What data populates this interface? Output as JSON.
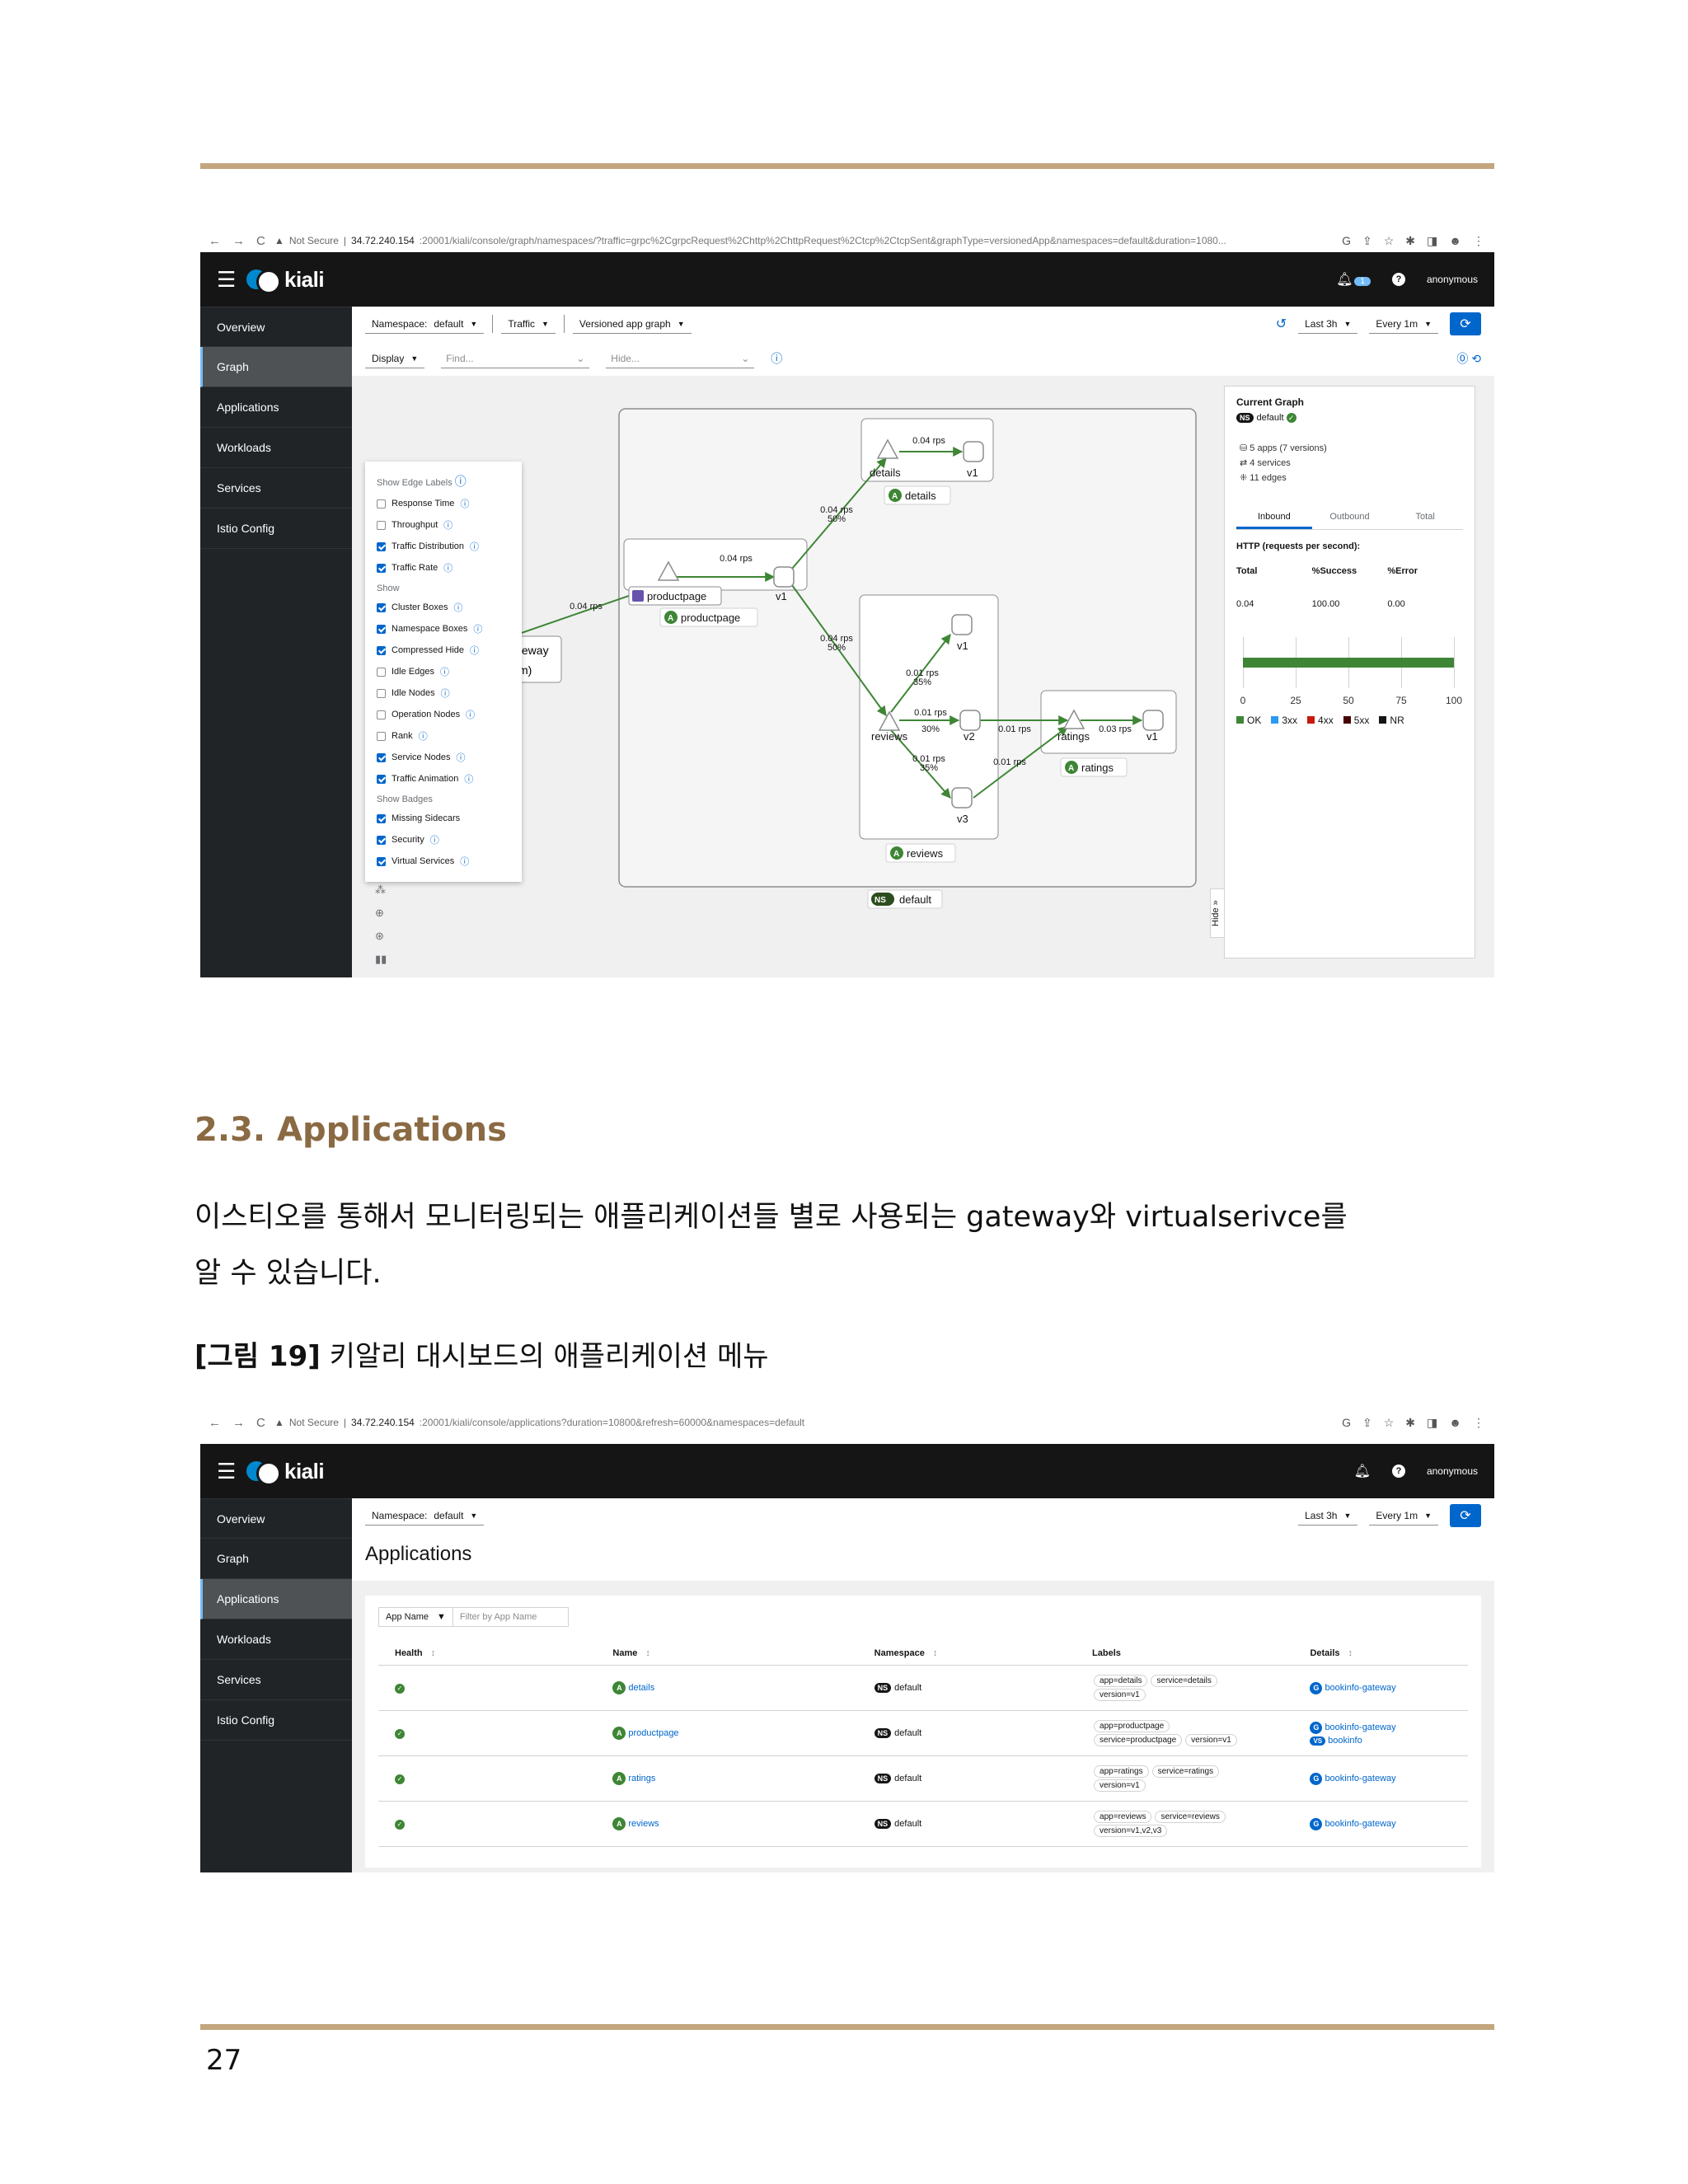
{
  "screenshot1": {
    "nav_back": "←",
    "nav_forward": "→",
    "nav_reload": "C",
    "security": "Not Secure",
    "host": "34.72.240.154",
    "path": ":20001/kiali/console/graph/namespaces/?traffic=grpc%2CgrpcRequest%2Chttp%2ChttpRequest%2Ctcp%2CtcpSent&graphType=versionedApp&namespaces=default&duration=1080...",
    "app_name": "kiali",
    "user": "anonymous",
    "notif_count": "1",
    "sidebar": [
      "Overview",
      "Graph",
      "Applications",
      "Workloads",
      "Services",
      "Istio Config"
    ],
    "active_item": "Graph",
    "toolbar": {
      "namespace_label": "Namespace:",
      "namespace_value": "default",
      "traffic": "Traffic",
      "graph_type": "Versioned app graph",
      "range": "Last 3h",
      "refresh": "Every 1m"
    },
    "subbar": {
      "display": "Display",
      "find_placeholder": "Find...",
      "hide_placeholder": "Hide..."
    },
    "display_menu": {
      "edge_labels_header": "Show Edge Labels",
      "edge_labels": [
        {
          "label": "Response Time",
          "checked": false
        },
        {
          "label": "Throughput",
          "checked": false
        },
        {
          "label": "Traffic Distribution",
          "checked": true
        },
        {
          "label": "Traffic Rate",
          "checked": true
        }
      ],
      "show_header": "Show",
      "show": [
        {
          "label": "Cluster Boxes",
          "checked": true
        },
        {
          "label": "Namespace Boxes",
          "checked": true
        },
        {
          "label": "Compressed Hide",
          "checked": true
        },
        {
          "label": "Idle Edges",
          "checked": false
        },
        {
          "label": "Idle Nodes",
          "checked": false
        },
        {
          "label": "Operation Nodes",
          "checked": false
        },
        {
          "label": "Rank",
          "checked": false
        },
        {
          "label": "Service Nodes",
          "checked": true
        },
        {
          "label": "Traffic Animation",
          "checked": true
        }
      ],
      "badges_header": "Show Badges",
      "badges": [
        {
          "label": "Missing Sidecars",
          "checked": true
        },
        {
          "label": "Security",
          "checked": true
        },
        {
          "label": "Virtual Services",
          "checked": true
        }
      ]
    },
    "graph": {
      "details_box": "details",
      "details_v1": "v1",
      "details_rate": "0.04 rps",
      "details_in_rate": "0.04 rps",
      "details_in_pct": "50%",
      "productpage_svc": "productpage",
      "productpage_v1": "v1",
      "productpage_app": "productpage",
      "productpage_rate": "0.04 rps",
      "gateway_rate": "0.04 rps",
      "gateway_text_1": "teway",
      "gateway_text_2": "m)",
      "reviews_in_rate": "0.04 rps",
      "reviews_in_pct": "50%",
      "reviews_svc": "reviews",
      "reviews_v1": "v1",
      "reviews_v2": "v2",
      "reviews_v3": "v3",
      "reviews_app": "reviews",
      "rv1_rate": "0.01 rps",
      "rv1_pct": "35%",
      "rv2_rate": "0.01 rps",
      "rv2_pct": "30%",
      "rv3_rate": "0.01 rps",
      "rv3_pct": "35%",
      "v2_ratings_rate": "0.01 rps",
      "v3_ratings_rate": "0.01 rps",
      "ratings_rate": "0.03 rps",
      "ratings_svc": "ratings",
      "ratings_v1": "v1",
      "ratings_app": "ratings",
      "ns_label": "default",
      "ns_badge": "NS",
      "app_badge": "A",
      "hide": "Hide"
    },
    "summary": {
      "title": "Current Graph",
      "namespace": "default",
      "apps": "5 apps (7 versions)",
      "services": "4 services",
      "edges": "11 edges",
      "tabs": [
        "Inbound",
        "Outbound",
        "Total"
      ],
      "http_header": "HTTP (requests per second):",
      "columns": [
        "Total",
        "%Success",
        "%Error"
      ],
      "values": [
        "0.04",
        "100.00",
        "0.00"
      ],
      "legend": [
        "OK",
        "3xx",
        "4xx",
        "5xx",
        "NR"
      ],
      "legend_colors": [
        "#3e8635",
        "#2b9af3",
        "#c9190b",
        "#470000",
        "#151515"
      ]
    },
    "chart_data": {
      "type": "bar",
      "categories": [
        "HTTP"
      ],
      "series": [
        {
          "name": "OK",
          "values": [
            100
          ]
        }
      ],
      "xlim": [
        0,
        100
      ],
      "ticks": [
        "0",
        "25",
        "50",
        "75",
        "100"
      ]
    }
  },
  "section": {
    "heading": "2.3. Applications",
    "paragraph_line1": "이스티오를 통해서 모니터링되는 애플리케이션들 별로 사용되는 gateway와 virtualserivce를",
    "paragraph_line2": "알 수 있습니다.",
    "caption_bold": "[그림 19]",
    "caption_text": " 키알리 대시보드의 애플리케이션 메뉴"
  },
  "screenshot2": {
    "security": "Not Secure",
    "host": "34.72.240.154",
    "path": ":20001/kiali/console/applications?duration=10800&refresh=60000&namespaces=default",
    "app_name": "kiali",
    "user": "anonymous",
    "sidebar": [
      "Overview",
      "Graph",
      "Applications",
      "Workloads",
      "Services",
      "Istio Config"
    ],
    "active_item": "Applications",
    "namespace_label": "Namespace:",
    "namespace_value": "default",
    "range": "Last 3h",
    "refresh": "Every 1m",
    "page_title": "Applications",
    "filter_select": "App Name",
    "filter_placeholder": "Filter by App Name",
    "columns": [
      "Health",
      "Name",
      "Namespace",
      "Labels",
      "Details"
    ],
    "rows": [
      {
        "name": "details",
        "namespace": "default",
        "labels": [
          "app=details",
          "service=details",
          "version=v1"
        ],
        "details": [
          "bookinfo-gateway"
        ]
      },
      {
        "name": "productpage",
        "namespace": "default",
        "labels": [
          "app=productpage",
          "service=productpage",
          "version=v1"
        ],
        "details": [
          "bookinfo-gateway",
          "bookinfo"
        ]
      },
      {
        "name": "ratings",
        "namespace": "default",
        "labels": [
          "app=ratings",
          "service=ratings",
          "version=v1"
        ],
        "details": [
          "bookinfo-gateway"
        ]
      },
      {
        "name": "reviews",
        "namespace": "default",
        "labels": [
          "app=reviews",
          "service=reviews",
          "version=v1,v2,v3"
        ],
        "details": [
          "bookinfo-gateway"
        ]
      }
    ]
  },
  "page_number": "27"
}
